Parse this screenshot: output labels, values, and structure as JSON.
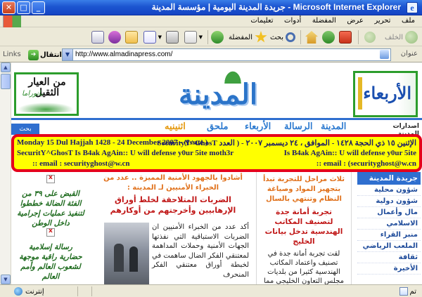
{
  "window": {
    "title": "Microsoft Internet Explorer - جريدة المدينة اليومية | مؤسسة المدينة",
    "app_icon": "e"
  },
  "menu": {
    "items": [
      "ملف",
      "تحرير",
      "عرض",
      "المفضلة",
      "أدوات",
      "تعليمات"
    ]
  },
  "toolbar": {
    "back_label": "الخلف",
    "search_label": "بحث",
    "favorites_label": "المفضلة"
  },
  "address": {
    "label": "عنوان",
    "url": "http://www.almadinapress.com/",
    "go_label": "انتقال",
    "links_label": "Links"
  },
  "masthead": {
    "logo_text": "المدينة",
    "ad_left_text": "من العيار الثقيل",
    "ad_left_script": "بانوراما",
    "ad_right_text": "الأربعاء"
  },
  "nav": {
    "archive_label": "اصدارات المدينة",
    "search_label": "بحث متقدم",
    "items": [
      "المدينة",
      "الأربعاء",
      "الرسالة",
      "الأربعاء",
      "ملحق",
      "اثنينيه"
    ]
  },
  "deface": {
    "line1_right": "الإثنين ١٥ ذي الحجة ١٤٢٨ - الموافق ، ٢٤ ديسمبر ٢٠٠٧ - ( العدد SecurityY^GhosT",
    "line1_left": "Monday 15 Dul Hajjah 1428 - 24 December 2007 - (Issue )",
    "line2_left": "SecuritY^GhosT Is B4ak AgAin:: U will defense y0ur 5ite moth3r",
    "line2_right": "Is B4ak AgAin:: U will defense y0ur 5ite",
    "line3_left": ":: email : securityghost@w.cn",
    "line3_right": ":: email : (securityghost@w.cn"
  },
  "side_ads": [
    "القبض على ٣٩ من الفئة الضالة خططوا لتنفيذ عمليات إجرامية داخل الوطن",
    "رسالة إسلامية حضارية راقية موجهة لشعوب العالم وأمم العالم"
  ],
  "article": {
    "kicker": "أشادوا بالجهود الأمنية المميزة .. عدد من الخبراء الأمنيين لـ المدينة :",
    "headline": "الضربات المتلاحقة لخلط أوراق الإرهابيين وأخرجتهم من أوكارهم",
    "body": "أكد عدد من الخبراء الأمنيين ان الضربات الاستباقية التي نفذتها الجهات الأمنية وحملات المداهمة لمعتنقي الفكر الضال ساهمت في لخبطة أوراق معتنقي الفكر المنحرف"
  },
  "center_box": {
    "kicker": "ثلاث مراحل للتجربة تبدأ بتجهيز المواد وصياغة النظام وتنتهي بالسال",
    "headline": "تجربة أمانة جدة لتصنيف المكاتب الهندسية تدخل بيانات الخليج",
    "body": "لقت تجربة أمانة جدة في تصنيف واعتماد المكاتب الهندسية كثيرا من بلديات مجلس التعاون الخليجي مما"
  },
  "right_nav": {
    "header": "جريدة المدينة",
    "items": [
      "شؤون محلية",
      "شؤون دولية",
      "مال وأعمال",
      "الاسلامي",
      "منبر القراء",
      "الملعب الرياضي",
      "ثقافة",
      "الأخيرة"
    ]
  },
  "status": {
    "done_label": "تم",
    "zone_label": "إنترنت"
  }
}
